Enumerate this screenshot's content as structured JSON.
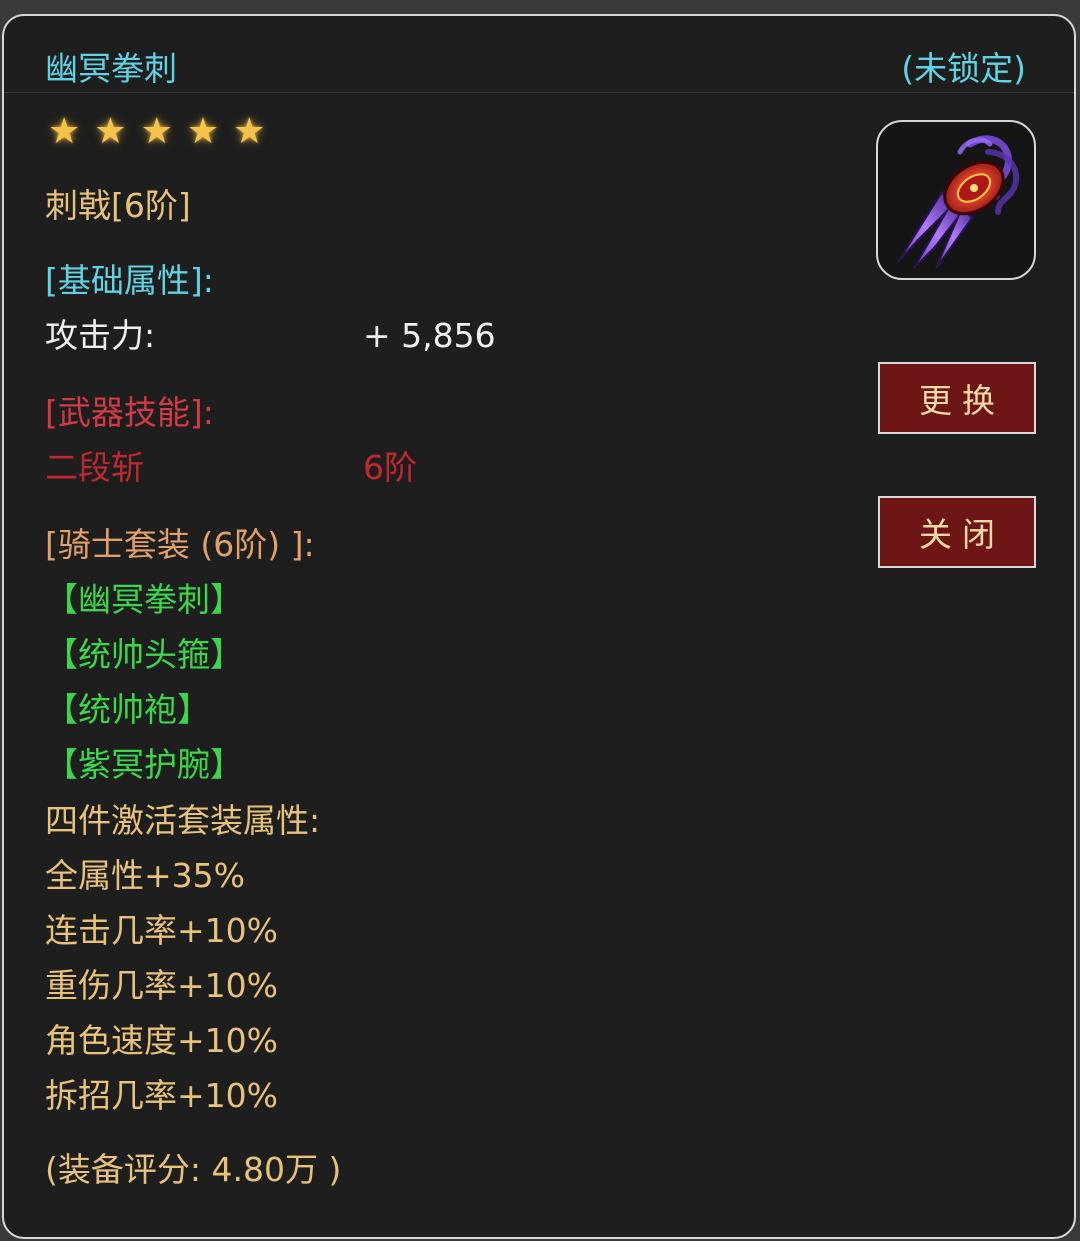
{
  "item": {
    "name": "幽冥拳刺",
    "lock_status": "(未锁定)",
    "stars": 5,
    "type": "刺戟[6阶]"
  },
  "base_attrs": {
    "header": "[基础属性]:",
    "attack_label": "攻击力:",
    "attack_value": "+ 5,856"
  },
  "weapon_skill": {
    "header": "[武器技能]:",
    "name": "二段斩",
    "level": "6阶"
  },
  "set": {
    "header": "[骑士套装 (6阶) ]:",
    "items": [
      "【幽冥拳刺】",
      "【统帅头箍】",
      "【统帅袍】",
      "【紫冥护腕】"
    ],
    "bonus_header": "四件激活套装属性:",
    "bonuses": [
      "全属性+35%",
      "连击几率+10%",
      "重伤几率+10%",
      "角色速度+10%",
      "拆招几率+10%"
    ]
  },
  "score": "(装备评分: 4.80万 )",
  "buttons": {
    "change": "更换",
    "close": "关闭"
  },
  "colors": {
    "title": "#5fd3e3",
    "gold_text": "#e8c27a",
    "skill_red": "#c0282f",
    "set_green": "#3cd64a",
    "button_bg": "#6e1616"
  }
}
